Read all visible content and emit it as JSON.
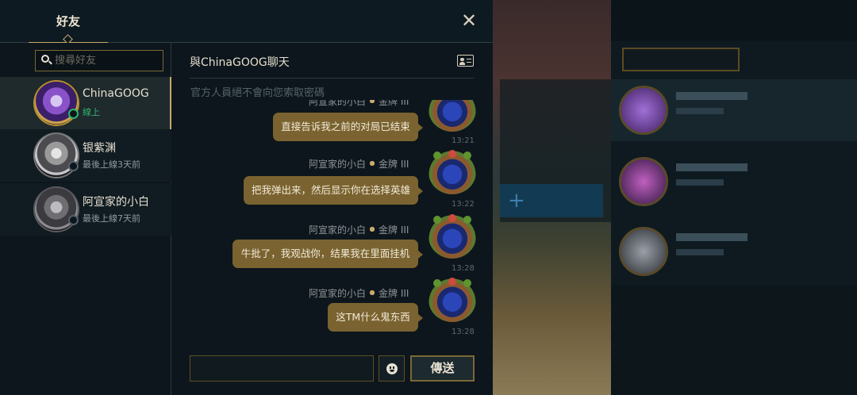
{
  "header": {
    "tab_label": "好友",
    "close_glyph": "✕"
  },
  "search": {
    "placeholder": "搜尋好友",
    "icon": "search-icon"
  },
  "friends": [
    {
      "name": "ChinaGOOG",
      "status": "線上",
      "online": true,
      "avatar": "purple-poro-icon"
    },
    {
      "name": "银紫渊",
      "status": "最後上線3天前",
      "online": false,
      "avatar": "silver-emblem"
    },
    {
      "name": "阿宣家的小白",
      "status": "最後上線7天前",
      "online": false,
      "avatar": "iron-emblem"
    }
  ],
  "chat": {
    "title": "與ChinaGOOG聊天",
    "notice": "官方人員絕不會向您索取密碼",
    "messages": [
      {
        "sender": "阿宣家的小白",
        "rank": "金牌 III",
        "text": "直接告诉我之前的对局已结束",
        "time": "13:21"
      },
      {
        "sender": "阿宣家的小白",
        "rank": "金牌 III",
        "text": "把我弹出来，然后显示你在选择英雄",
        "time": "13:22"
      },
      {
        "sender": "阿宣家的小白",
        "rank": "金牌 III",
        "text": "牛批了，我观战你，结果我在里面挂机",
        "time": "13:28"
      },
      {
        "sender": "阿宣家的小白",
        "rank": "金牌 III",
        "text": "这TM什么鬼东西",
        "time": "13:28"
      }
    ],
    "input_value": "",
    "send_label": "傳送"
  },
  "colors": {
    "accent_gold": "#c8aa6e",
    "bubble": "#7a6330",
    "online_green": "#2fb36d"
  }
}
